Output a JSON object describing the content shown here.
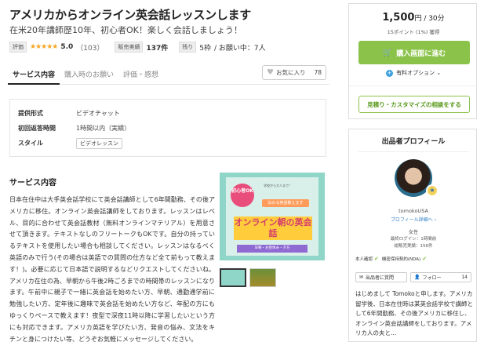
{
  "service": {
    "title": "アメリカからオンライン英会話レッスンします",
    "subtitle": "在米20年講師歴10年、初心者OK！楽しく会話しましょう！",
    "stats": {
      "rating_tag": "評価",
      "stars": "★★★★★",
      "rating": "5.0",
      "review_count": "（103）",
      "sales_tag": "販売実績",
      "sales_count": "137件",
      "remaining_tag": "残り",
      "remaining_value": "5枠",
      "negotiating": "/ お願い中：7人"
    },
    "tabs": [
      {
        "label": "サービス内容"
      },
      {
        "label": "購入時のお願い"
      },
      {
        "label": "評価・感想"
      }
    ],
    "favorite": {
      "label": "お気に入り",
      "count": "78"
    },
    "info": {
      "format_label": "提供形式",
      "format_value": "ビデオチャット",
      "response_label": "初回返答時間",
      "response_value": "1時間以内（実績）",
      "style_label": "スタイル",
      "style_value": "ビデオレッスン"
    },
    "section_title": "サービス内容",
    "description": "日本在住中は大手英会話学校にて英会話講師として6年間勤務、その後アメリカに移住。オンライン英会話講師をしております。レッスンはレベル、目的に合わせて英会話教材（無料オンラインマテリアル）を用意させて頂きます。テキストなしのフリートークもOKです。自分の持っているテキストを使用したい場合も相談してください。レッスンはなるべく英語のみで行う(その場合は英語での質問の仕方など全て前もって教えます！)。必要に応じて日本語で説明するなどリクエストしてくださいね。アメリカ在住の為、早朝から午後2時ごろまでの時間帯のレッスンになります。午前中に親子で一緒に英会話を始めたい方、早朝、通勤通学前に勉強したい方、定年後に趣味で英会話を始めたい方など、年配の方にもゆっくりペースで教えます！夜型で深夜11時以降に学習したいという方にも対応できます。アメリカ英語を学びたい方、発音の悩み、文法をキチンと身につけたい等、どうぞお気軽にメッセージしてください。",
    "hero": {
      "badge": "初心者OK",
      "small_text": "学校から大人まで！",
      "banner": "伝わる英語教えます",
      "main": "オンライン朝の英会話",
      "bottom": "早朝・お昼休み・夕方"
    }
  },
  "purchase": {
    "price": "1,500",
    "price_unit": "円 / 30分",
    "points": "15ポイント (1%) 獲得",
    "buy_label": "購入画面に進む",
    "option_label": "有料オプション",
    "consult_label": "見積り・カスタマイズの相談をする"
  },
  "profile": {
    "title": "出品者プロフィール",
    "username": "tomokoUSA",
    "plevel": "プロフィール詳細へ ›",
    "gender": "女性",
    "login": "最終ログイン：1時間前",
    "sales": "総販売実績：156件",
    "verify_identity": "本人確認",
    "verify_nda": "機密保持契約(NDA)",
    "message_label": "出品者に質問",
    "follow_label": "フォロー",
    "follow_count": "14",
    "intro": "はじめまして Tomokoと申します。アメリカ留学後、日本在住時は某英会話学校で講師として6年間勤務、その後アメリカに移住し、オンライン英会話講師をしております。アメリカ人の夫と..."
  },
  "colors": {
    "accent_green": "#8bc34a",
    "star": "#f5a623",
    "link_blue": "#2f7fc4"
  }
}
